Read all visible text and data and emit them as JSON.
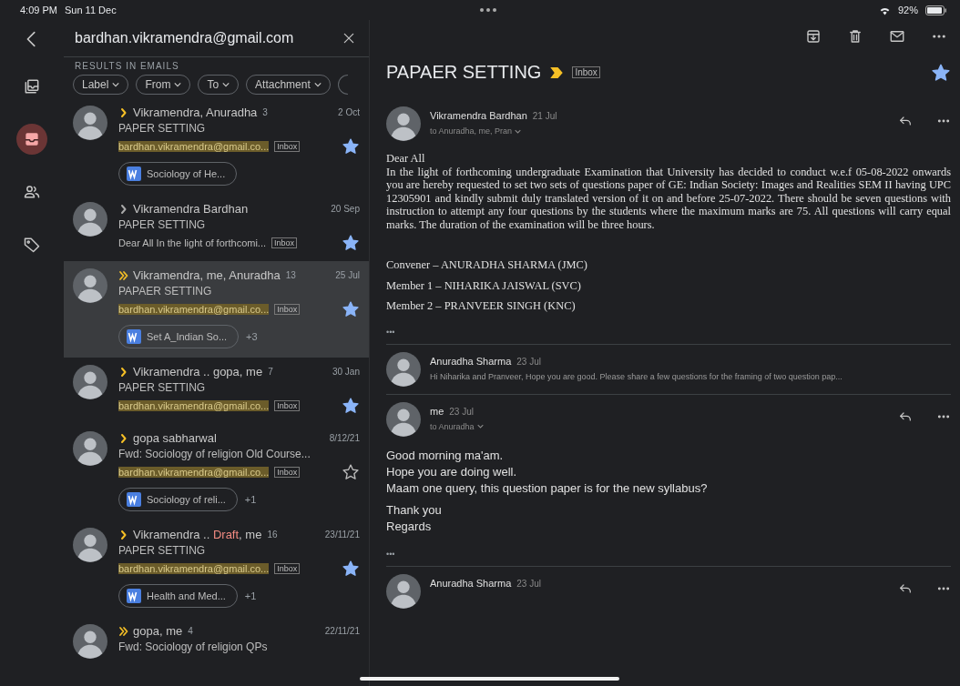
{
  "status_bar": {
    "time": "4:09 PM",
    "date": "Sun 11 Dec",
    "battery": "92%"
  },
  "rail": [
    {
      "kind": "stack",
      "selected": false
    },
    {
      "kind": "inbox",
      "selected": true
    },
    {
      "kind": "people",
      "selected": false
    },
    {
      "kind": "tag",
      "selected": false
    }
  ],
  "search": {
    "value": "bardhan.vikramendra@gmail.com"
  },
  "section_label": "RESULTS IN EMAILS",
  "filters": [
    "Label",
    "From",
    "To",
    "Attachment"
  ],
  "results": [
    {
      "double_marker": false,
      "important": true,
      "sender": [
        {
          "text": "Vikramendra, Anuradha",
          "draft": false
        }
      ],
      "count": "3",
      "date": "2 Oct",
      "subject": "PAPER SETTING",
      "snippet": "bardhan.vikramendra@gmail.co...",
      "snippet_match": true,
      "label": "Inbox",
      "starred": true,
      "attachment": "Sociology of He...",
      "selected": false
    },
    {
      "double_marker": false,
      "important": false,
      "sender": [
        {
          "text": "Vikramendra Bardhan",
          "draft": false
        }
      ],
      "date": "20 Sep",
      "subject": "PAPER SETTING",
      "snippet": "Dear All In the light of forthcomi...",
      "snippet_match": false,
      "label": "Inbox",
      "starred": true,
      "selected": false
    },
    {
      "double_marker": true,
      "important": true,
      "sender": [
        {
          "text": "Vikramendra, me, Anuradha",
          "draft": false
        }
      ],
      "count": "13",
      "date": "25 Jul",
      "subject": "PAPAER SETTING",
      "snippet": "bardhan.vikramendra@gmail.co...",
      "snippet_match": true,
      "label": "Inbox",
      "starred": true,
      "attachment": "Set A_Indian So...",
      "more": "+3",
      "selected": true
    },
    {
      "double_marker": false,
      "important": true,
      "sender": [
        {
          "text": "Vikramendra .. gopa, me",
          "draft": false
        }
      ],
      "count": "7",
      "date": "30 Jan",
      "subject": "PAPER SETTING",
      "snippet": "bardhan.vikramendra@gmail.co...",
      "snippet_match": true,
      "label": "Inbox",
      "starred": true,
      "selected": false
    },
    {
      "double_marker": false,
      "important": true,
      "sender": [
        {
          "text": "gopa sabharwal",
          "draft": false
        }
      ],
      "date": "8/12/21",
      "subject": "Fwd: Sociology of religion Old Course...",
      "snippet": "bardhan.vikramendra@gmail.co...",
      "snippet_match": true,
      "label": "Inbox",
      "starred": false,
      "attachment": "Sociology of reli...",
      "more": "+1",
      "selected": false
    },
    {
      "double_marker": false,
      "important": true,
      "sender": [
        {
          "text": "Vikramendra .. ",
          "draft": false
        },
        {
          "text": "Draft",
          "draft": true
        },
        {
          "text": ", me",
          "draft": false
        }
      ],
      "count": "16",
      "date": "23/11/21",
      "subject": "PAPER SETTING",
      "snippet": "bardhan.vikramendra@gmail.co...",
      "snippet_match": true,
      "label": "Inbox",
      "starred": true,
      "attachment": "Health and Med...",
      "more": "+1",
      "selected": false
    },
    {
      "double_marker": true,
      "important": true,
      "sender": [
        {
          "text": "gopa, me",
          "draft": false
        }
      ],
      "count": "4",
      "date": "22/11/21",
      "subject": "Fwd: Sociology of religion QPs",
      "selected": false
    }
  ],
  "thread": {
    "subject": "PAPAER SETTING",
    "important": true,
    "label": "Inbox",
    "starred": true,
    "messages": [
      {
        "kind": "document",
        "sender": "Vikramendra Bardhan",
        "date": "21 Jul",
        "to": "to Anuradha, me, Pran",
        "paragraphs": [
          "Dear All\nIn the light of forthcoming undergraduate Examination that University has decided to conduct w.e.f 05-08-2022 onwards you are hereby requested to set two sets of questions paper of GE: Indian Society: Images and Realities SEM II having UPC 12305901  and kindly submit duly translated version of it on and before 25-07-2022. There should be seven questions with instruction to attempt any four questions by the students where the maximum marks are 75. All questions will carry equal marks. The duration of the examination will be three hours.",
          "Convener – ANURADHA SHARMA (JMC)",
          "Member 1 – NIHARIKA JAISWAL (SVC)",
          "Member 2 – PRANVEER SINGH (KNC)"
        ],
        "trimmed": "•••"
      },
      {
        "kind": "collapsed",
        "sender": "Anuradha Sharma",
        "date": "23 Jul",
        "snippet": "Hi Niharika and Pranveer, Hope you are good. Please share a few questions for the framing of two question pap..."
      },
      {
        "kind": "plain",
        "sender": "me",
        "date": "23 Jul",
        "to": "to Anuradha",
        "paragraphs": [
          "Good morning ma'am.\nHope you are doing well.\nMaam one query, this question paper is for the new syllabus?",
          "Thank you\nRegards"
        ],
        "trimmed": "•••"
      },
      {
        "kind": "partial",
        "sender": "Anuradha Sharma",
        "date": "23 Jul"
      }
    ]
  }
}
